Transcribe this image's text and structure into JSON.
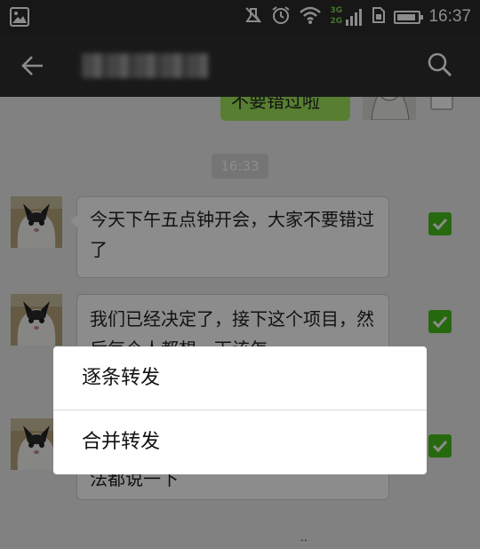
{
  "status_bar": {
    "time": "16:37",
    "network_top": "3G",
    "network_bottom": "2G",
    "battery_level_percent": 90,
    "icons": [
      "image-notification-icon",
      "mute-icon",
      "alarm-icon",
      "wifi-icon",
      "signal-icon",
      "sim-icon",
      "battery-icon"
    ]
  },
  "header": {
    "title": "██████",
    "back_icon": "arrow-left-icon",
    "search_icon": "search-icon"
  },
  "messages": [
    {
      "side": "right",
      "text": "不要错过啦",
      "selected": false
    },
    {
      "side": "left",
      "text": "今天下午五点钟开会，大家不要错过了",
      "selected": true
    },
    {
      "side": "left",
      "text": "我们已经决定了，接下这个项目，然后每个人都想一下该怎",
      "selected": true
    },
    {
      "side": "left",
      "text": "法都说一下",
      "selected": true
    }
  ],
  "timestamp": "16:33",
  "footer_dots": "..",
  "forward_dialog": {
    "options": [
      "逐条转发",
      "合并转发"
    ]
  },
  "colors": {
    "accent_green": "#45c01a",
    "sent_bubble": "#9fe65a",
    "title_bar": "#2e2e2e"
  }
}
